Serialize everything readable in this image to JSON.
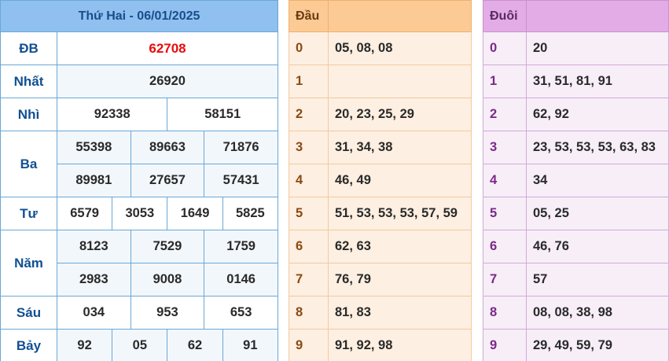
{
  "results": {
    "title": "Thứ Hai - 06/01/2025",
    "prizes": {
      "db": {
        "label": "ĐB",
        "values": [
          "62708"
        ]
      },
      "nhat": {
        "label": "Nhất",
        "values": [
          "26920"
        ]
      },
      "nhi": {
        "label": "Nhì",
        "values": [
          "92338",
          "58151"
        ]
      },
      "ba": {
        "label": "Ba",
        "values": [
          "55398",
          "89663",
          "71876",
          "89981",
          "27657",
          "57431"
        ]
      },
      "tu": {
        "label": "Tư",
        "values": [
          "6579",
          "3053",
          "1649",
          "5825"
        ]
      },
      "nam": {
        "label": "Năm",
        "values": [
          "8123",
          "7529",
          "1759",
          "2983",
          "9008",
          "0146"
        ]
      },
      "sau": {
        "label": "Sáu",
        "values": [
          "034",
          "953",
          "653"
        ]
      },
      "bay": {
        "label": "Bảy",
        "values": [
          "92",
          "05",
          "62",
          "91"
        ]
      }
    },
    "special_color": "#e80c0c"
  },
  "dau": {
    "header": "Đầu",
    "rows": [
      {
        "k": "0",
        "v": "05, 08, 08"
      },
      {
        "k": "1",
        "v": ""
      },
      {
        "k": "2",
        "v": "20, 23, 25, 29"
      },
      {
        "k": "3",
        "v": "31, 34, 38"
      },
      {
        "k": "4",
        "v": "46, 49"
      },
      {
        "k": "5",
        "v": "51, 53, 53, 53, 57, 59"
      },
      {
        "k": "6",
        "v": "62, 63"
      },
      {
        "k": "7",
        "v": "76, 79"
      },
      {
        "k": "8",
        "v": "81, 83"
      },
      {
        "k": "9",
        "v": "91, 92, 98"
      }
    ]
  },
  "duoi": {
    "header": "Đuôi",
    "rows": [
      {
        "k": "0",
        "v": "20"
      },
      {
        "k": "1",
        "v": "31, 51, 81, 91"
      },
      {
        "k": "2",
        "v": "62, 92"
      },
      {
        "k": "3",
        "v": "23, 53, 53, 53, 63, 83"
      },
      {
        "k": "4",
        "v": "34"
      },
      {
        "k": "5",
        "v": "05, 25"
      },
      {
        "k": "6",
        "v": "46, 76"
      },
      {
        "k": "7",
        "v": "57"
      },
      {
        "k": "8",
        "v": "08, 08, 38, 98"
      },
      {
        "k": "9",
        "v": "29, 49, 59, 79"
      }
    ]
  }
}
